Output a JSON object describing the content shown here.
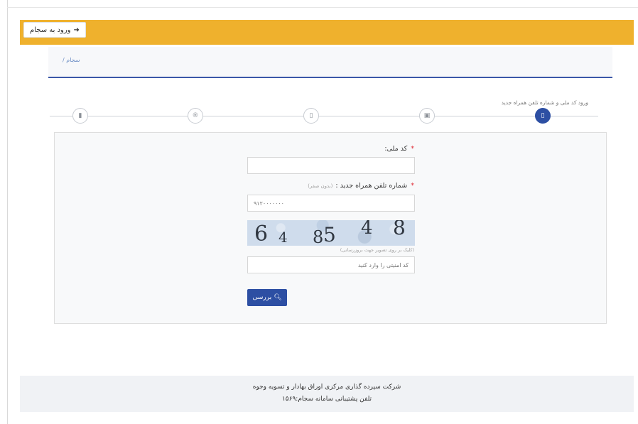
{
  "header": {
    "login_label": "ورود به سجام",
    "login_icon": "sign-in-icon",
    "color": "#efb12d"
  },
  "breadcrumb": {
    "text": "سجام /"
  },
  "stepper": {
    "caption": "ورود کد ملی و شماره تلفن همراه جدید",
    "steps": [
      {
        "icon": "mobile-icon",
        "glyph": "▯",
        "active": true
      },
      {
        "icon": "money-icon",
        "glyph": "▣",
        "active": false
      },
      {
        "icon": "mobile-outline-icon",
        "glyph": "▯",
        "active": false
      },
      {
        "icon": "registered-icon",
        "glyph": "®",
        "active": false
      },
      {
        "icon": "file-icon",
        "glyph": "▮",
        "active": false
      }
    ],
    "active_color": "#2d4fa3"
  },
  "form": {
    "national_code_label": "کد ملی:",
    "national_code_value": "",
    "phone_label": "شماره تلفن همراه جدید :",
    "phone_hint": "(بدون صفر)",
    "phone_placeholder": "۹۱۲۰۰۰۰۰۰۰",
    "captcha_text": "6 4 85 4 8",
    "captcha_hint": "(کلیک بر روی تصویر جهت بروزرسانی)",
    "captcha_placeholder": "کد امنیتی را وارد کنید",
    "required_mark": "*",
    "submit_label": "بررسی",
    "submit_icon": "search-icon"
  },
  "footer": {
    "line1": "شرکت سپرده گذاری مرکزی اوراق بهادار و تسویه وجوه",
    "line2": "تلفن پشتیبانی سامانه سجام:۱۵۶۹"
  }
}
